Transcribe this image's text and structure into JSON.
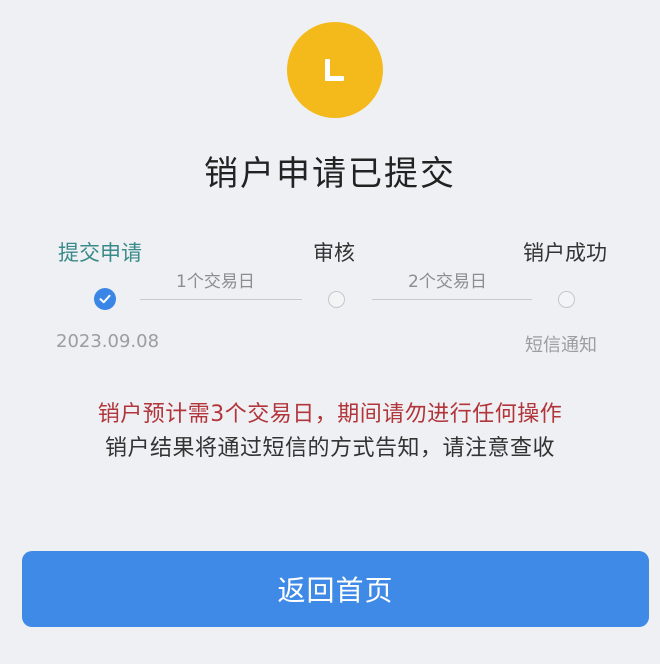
{
  "status": {
    "icon": "clock-icon",
    "color": "#f4b91a",
    "title": "销户申请已提交"
  },
  "progress": {
    "steps": [
      {
        "label": "提交申请",
        "state": "completed",
        "sub": "2023.09.08"
      },
      {
        "label": "审核",
        "state": "pending",
        "sub": ""
      },
      {
        "label": "销户成功",
        "state": "pending",
        "sub": "短信通知"
      }
    ],
    "connectors": [
      {
        "label": "1个交易日"
      },
      {
        "label": "2个交易日"
      }
    ]
  },
  "notice": {
    "warning": "销户预计需3个交易日，期间请勿进行任何操作",
    "info": "销户结果将通过短信的方式告知，请注意查收"
  },
  "actions": {
    "home_button_label": "返回首页"
  },
  "colors": {
    "primary": "#3f8ae6",
    "warning": "#b1353a",
    "active_step": "#3a8a8a"
  }
}
